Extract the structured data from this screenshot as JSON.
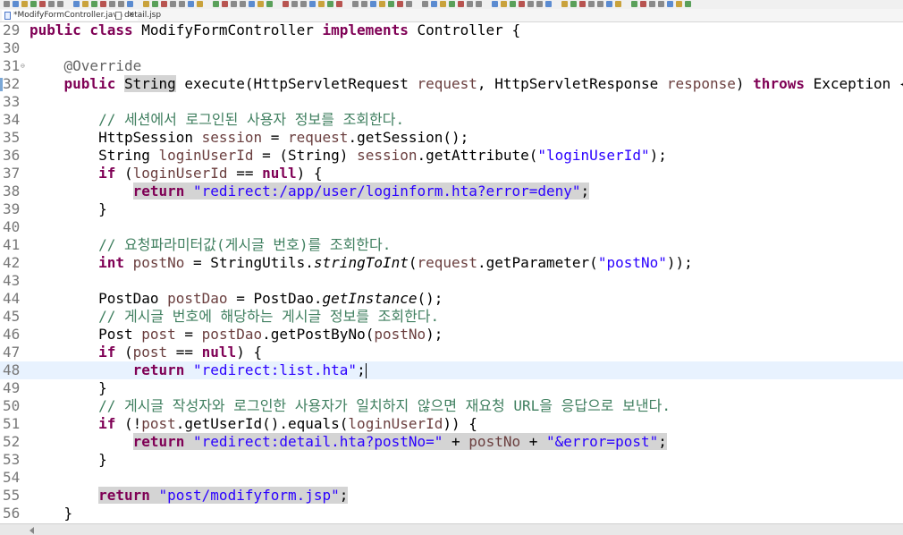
{
  "tabs": [
    {
      "label": "*ModifyFormController.java",
      "icon": "java-file-icon",
      "active": true
    },
    {
      "label": "detail.jsp",
      "icon": "jsp-file-icon",
      "active": false
    }
  ],
  "editor": {
    "lines": [
      {
        "num": "29",
        "html": "<span class=\"kw\">public class</span> ModifyFormController <span class=\"kw\">implements</span> Controller {"
      },
      {
        "num": "30",
        "html": ""
      },
      {
        "num": "31",
        "fold": true,
        "html": "    <span class=\"ann\">@Override</span>"
      },
      {
        "num": "32",
        "marker": true,
        "html": "    <span class=\"kw\">public</span> <span class=\"occ\">String</span> execute(HttpServletRequest <span class=\"var\">request</span>, HttpServletResponse <span class=\"var\">response</span>) <span class=\"kw\">throws</span> Exception {"
      },
      {
        "num": "33",
        "html": ""
      },
      {
        "num": "34",
        "html": "        <span class=\"cmt\">// 세션에서 로그인된 사용자 정보를 조회한다.</span>"
      },
      {
        "num": "35",
        "html": "        HttpSession <span class=\"var\">session</span> = <span class=\"var\">request</span>.getSession();"
      },
      {
        "num": "36",
        "html": "        String <span class=\"var\">loginUserId</span> = (String) <span class=\"var\">session</span>.getAttribute(<span class=\"str\">\"loginUserId\"</span>);"
      },
      {
        "num": "37",
        "html": "        <span class=\"kw\">if</span> (<span class=\"var\">loginUserId</span> == <span class=\"kw\">null</span>) {"
      },
      {
        "num": "38",
        "html": "            <span class=\"hl\"><span class=\"kw\">return</span> <span class=\"str\">\"redirect:/app/user/loginform.hta?error=deny\"</span>;</span>"
      },
      {
        "num": "39",
        "html": "        }"
      },
      {
        "num": "40",
        "html": ""
      },
      {
        "num": "41",
        "html": "        <span class=\"cmt\">// 요청파라미터값(게시글 번호)를 조회한다.</span>"
      },
      {
        "num": "42",
        "html": "        <span class=\"kw\">int</span> <span class=\"var\">postNo</span> = StringUtils.<span class=\"it\">stringToInt</span>(<span class=\"var\">request</span>.getParameter(<span class=\"str\">\"postNo\"</span>));"
      },
      {
        "num": "43",
        "html": ""
      },
      {
        "num": "44",
        "html": "        PostDao <span class=\"var\">postDao</span> = PostDao.<span class=\"it\">getInstance</span>();"
      },
      {
        "num": "45",
        "html": "        <span class=\"cmt\">// 게시글 번호에 해당하는 게시글 정보를 조회한다.</span>"
      },
      {
        "num": "46",
        "html": "        Post <span class=\"var\">post</span> = <span class=\"var\">postDao</span>.getPostByNo(<span class=\"var\">postNo</span>);"
      },
      {
        "num": "47",
        "html": "        <span class=\"kw\">if</span> (<span class=\"var\">post</span> == <span class=\"kw\">null</span>) {"
      },
      {
        "num": "48",
        "current": true,
        "html": "            <span class=\"kw\">return</span> <span class=\"str\">\"redirect:list.hta\"</span>;<span class=\"caret\"></span>"
      },
      {
        "num": "49",
        "html": "        }"
      },
      {
        "num": "50",
        "html": "        <span class=\"cmt\">// 게시글 작성자와 로그인한 사용자가 일치하지 않으면 재요청 URL을 응답으로 보낸다.</span>"
      },
      {
        "num": "51",
        "html": "        <span class=\"kw\">if</span> (!<span class=\"var\">post</span>.getUserId().equals(<span class=\"var\">loginUserId</span>)) {"
      },
      {
        "num": "52",
        "html": "            <span class=\"hl\"><span class=\"kw\">return</span> <span class=\"str\">\"redirect:detail.hta?postNo=\"</span> + <span class=\"var\">postNo</span> + <span class=\"str\">\"&amp;error=post\"</span>;</span>"
      },
      {
        "num": "53",
        "html": "        }"
      },
      {
        "num": "54",
        "html": ""
      },
      {
        "num": "55",
        "html": "        <span class=\"hl\"><span class=\"kw\">return</span> <span class=\"str\">\"post/modifyform.jsp\"</span>;</span>"
      },
      {
        "num": "56",
        "html": "    }"
      }
    ]
  },
  "colors": {
    "keyword": "#7f0055",
    "string": "#2a00ff",
    "comment": "#3f7f5f",
    "annotation": "#646464",
    "local_variable": "#6a3e3e",
    "current_line": "#e8f2fe",
    "occurrence_highlight": "#d4d4d4"
  }
}
